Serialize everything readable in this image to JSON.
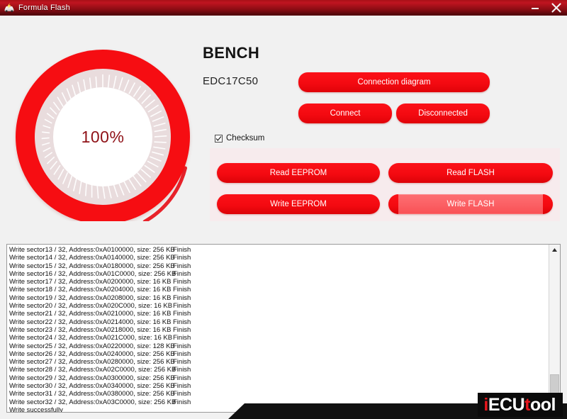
{
  "window": {
    "title": "Formula Flash",
    "icon": "car-flash-icon",
    "minimize_label": "–",
    "close_label": "✕",
    "titlebar_color": "#a81018"
  },
  "gauge": {
    "name": "progress-gauge",
    "percent_label": "100%",
    "percent_value": 100,
    "ring_color": "#f60d12",
    "inner_ring_color": "#e9dcdd",
    "text_color": "#8f1117"
  },
  "header": {
    "mode": "BENCH",
    "ecu": "EDC17C50"
  },
  "connection": {
    "diagram_label": "Connection diagram",
    "connect_label": "Connect",
    "disconnect_label": "Disconnected"
  },
  "options": {
    "checksum_label": "Checksum",
    "checksum_checked": true
  },
  "actions": {
    "read_eeprom_label": "Read EEPROM",
    "read_flash_label": "Read FLASH",
    "write_eeprom_label": "Write EEPROM",
    "write_flash_label": "Write FLASH",
    "active_action": "Write FLASH",
    "button_color": "#f40a11",
    "active_button_color": "#fb5f63",
    "panel_color": "#f7ebed"
  },
  "log": {
    "lines": [
      {
        "text": "Write sector13 / 32, Address:0xA0100000, size: 256 KB",
        "status": "Finish"
      },
      {
        "text": "Write sector14 / 32, Address:0xA0140000, size: 256 KB",
        "status": "Finish"
      },
      {
        "text": "Write sector15 / 32, Address:0xA0180000, size: 256 KB",
        "status": "Finish"
      },
      {
        "text": "Write sector16 / 32, Address:0xA01C0000, size: 256 KB",
        "status": "Finish"
      },
      {
        "text": "Write sector17 / 32, Address:0xA0200000, size: 16 KB",
        "status": "Finish"
      },
      {
        "text": "Write sector18 / 32, Address:0xA0204000, size: 16 KB",
        "status": "Finish"
      },
      {
        "text": "Write sector19 / 32, Address:0xA0208000, size: 16 KB",
        "status": "Finish"
      },
      {
        "text": "Write sector20 / 32, Address:0xA020C000, size: 16 KB",
        "status": "Finish"
      },
      {
        "text": "Write sector21 / 32, Address:0xA0210000, size: 16 KB",
        "status": "Finish"
      },
      {
        "text": "Write sector22 / 32, Address:0xA0214000, size: 16 KB",
        "status": "Finish"
      },
      {
        "text": "Write sector23 / 32, Address:0xA0218000, size: 16 KB",
        "status": "Finish"
      },
      {
        "text": "Write sector24 / 32, Address:0xA021C000, size: 16 KB",
        "status": "Finish"
      },
      {
        "text": "Write sector25 / 32, Address:0xA0220000, size: 128 KB",
        "status": "Finish"
      },
      {
        "text": "Write sector26 / 32, Address:0xA0240000, size: 256 KB",
        "status": "Finish"
      },
      {
        "text": "Write sector27 / 32, Address:0xA0280000, size: 256 KB",
        "status": "Finish"
      },
      {
        "text": "Write sector28 / 32, Address:0xA02C0000, size: 256 KB",
        "status": "Finish"
      },
      {
        "text": "Write sector29 / 32, Address:0xA0300000, size: 256 KB",
        "status": "Finish"
      },
      {
        "text": "Write sector30 / 32, Address:0xA0340000, size: 256 KB",
        "status": "Finish"
      },
      {
        "text": "Write sector31 / 32, Address:0xA0380000, size: 256 KB",
        "status": "Finish"
      },
      {
        "text": "Write sector32 / 32, Address:0xA03C0000, size: 256 KB",
        "status": "Finish"
      },
      {
        "text": "Write successfully",
        "status": ""
      }
    ]
  },
  "watermark": {
    "part1": "i",
    "part2": "ECU",
    "part3": "t",
    "part4": "ool",
    "full": "iECUtool"
  }
}
